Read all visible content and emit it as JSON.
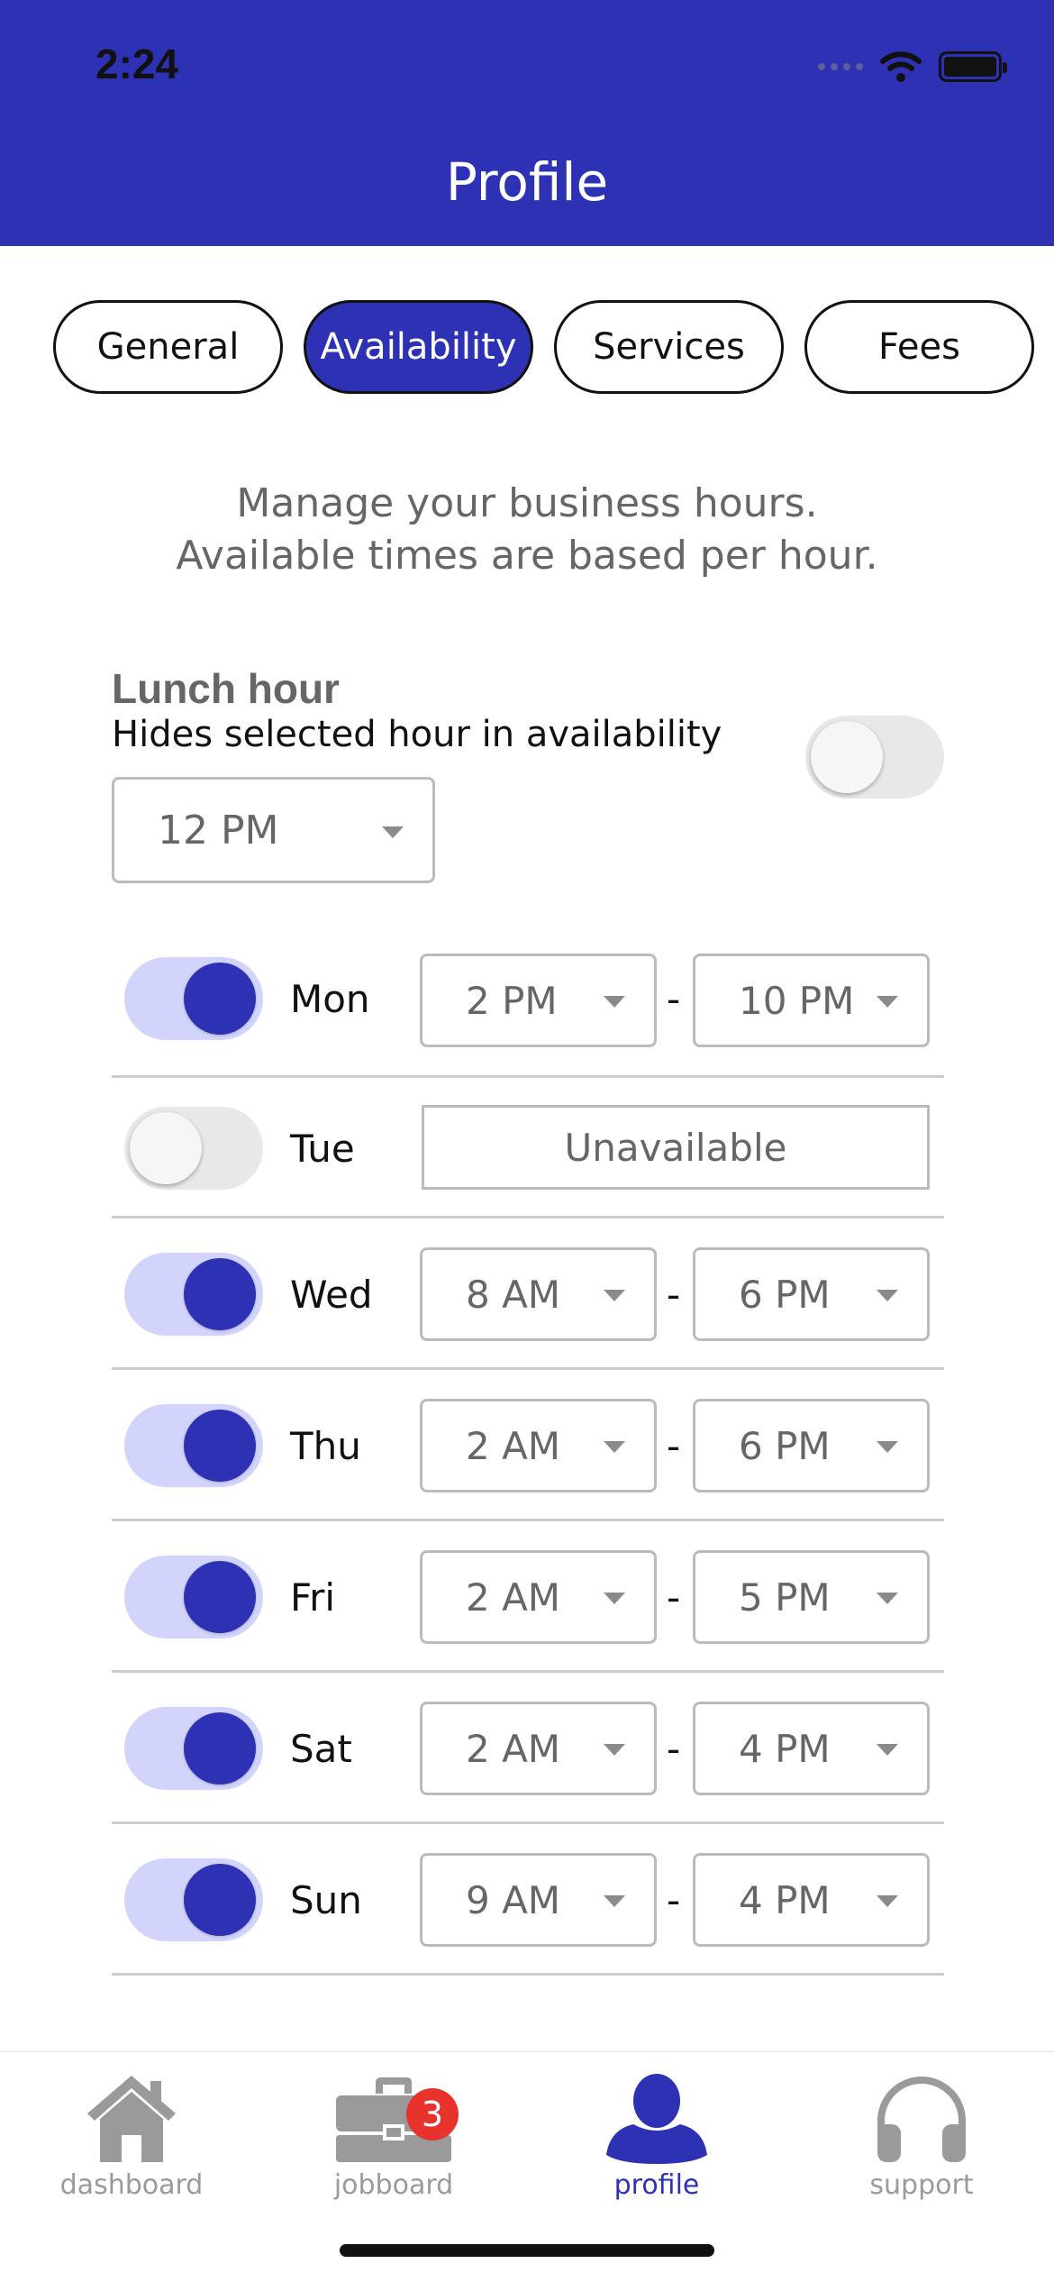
{
  "status_bar": {
    "time": "2:24"
  },
  "header": {
    "title": "Profile"
  },
  "tabs": [
    {
      "label": "General",
      "active": false
    },
    {
      "label": "Availability",
      "active": true
    },
    {
      "label": "Services",
      "active": false
    },
    {
      "label": "Fees",
      "active": false
    }
  ],
  "intro": {
    "line1": "Manage your business hours.",
    "line2": "Available times are based per hour."
  },
  "lunch": {
    "title": "Lunch hour",
    "description": "Hides selected hour in availability",
    "selected": "12 PM",
    "enabled": false
  },
  "days": [
    {
      "label": "Mon",
      "enabled": true,
      "start": "2 PM",
      "end": "10 PM"
    },
    {
      "label": "Tue",
      "enabled": false,
      "unavailable_text": "Unavailable"
    },
    {
      "label": "Wed",
      "enabled": true,
      "start": "8 AM",
      "end": "6 PM"
    },
    {
      "label": "Thu",
      "enabled": true,
      "start": "2 AM",
      "end": "6 PM"
    },
    {
      "label": "Fri",
      "enabled": true,
      "start": "2 AM",
      "end": "5 PM"
    },
    {
      "label": "Sat",
      "enabled": true,
      "start": "2 AM",
      "end": "4 PM"
    },
    {
      "label": "Sun",
      "enabled": true,
      "start": "9 AM",
      "end": "4 PM"
    }
  ],
  "range_separator": "-",
  "bottom_nav": {
    "dashboard": {
      "label": "dashboard",
      "icon": "house-icon"
    },
    "jobboard": {
      "label": "jobboard",
      "icon": "briefcase-icon",
      "badge": "3"
    },
    "profile": {
      "label": "profile",
      "icon": "person-icon",
      "active": true
    },
    "support": {
      "label": "support",
      "icon": "headphones-icon"
    }
  },
  "colors": {
    "primary": "#2d31b3",
    "toggle_track_on": "#d3d4fb",
    "badge": "#e8322c",
    "muted_text": "#666666"
  }
}
